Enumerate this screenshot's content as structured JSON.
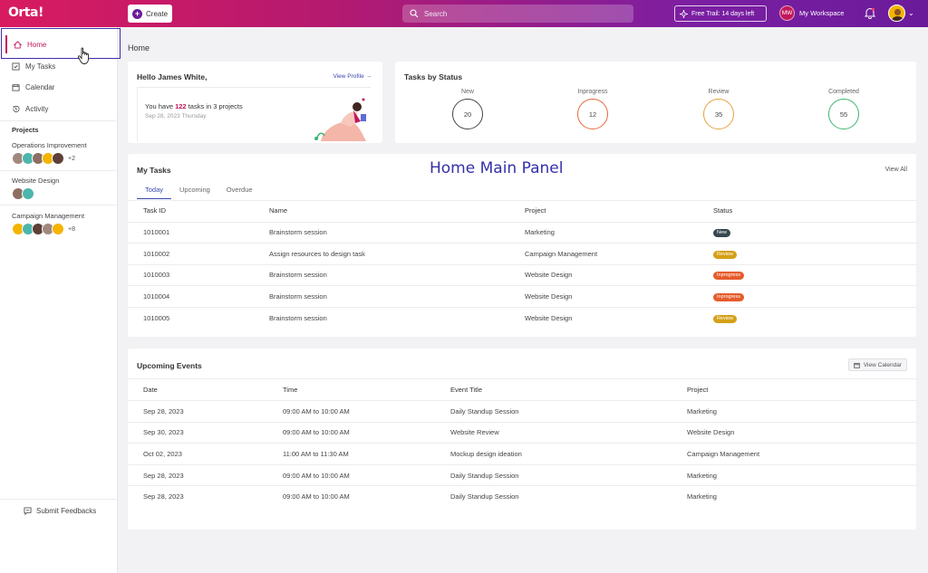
{
  "topbar": {
    "logo": "Orta!",
    "create_label": "Create",
    "search_placeholder": "Search",
    "trial_label": "Free Trail: 14 days left",
    "workspace_initials": "MW",
    "workspace_label": "My Workspace"
  },
  "sidebar": {
    "items": [
      {
        "label": "Home",
        "icon": "home-icon"
      },
      {
        "label": "My Tasks",
        "icon": "checkbox-icon"
      },
      {
        "label": "Calendar",
        "icon": "calendar-icon"
      },
      {
        "label": "Activity",
        "icon": "history-icon"
      }
    ],
    "projects_title": "Projects",
    "projects": [
      {
        "name": "Operations Improvement",
        "more": "+2"
      },
      {
        "name": "Website Design",
        "more": ""
      },
      {
        "name": "Campaign Management",
        "more": "+8"
      }
    ],
    "submit_label": "Submit Feedbacks"
  },
  "breadcrumb": "Home",
  "hello": {
    "title": "Hello James White,",
    "view_profile": "View Profile →",
    "tasks_prefix": "You have ",
    "tasks_count": "122",
    "tasks_suffix": " tasks in 3 projects",
    "date": "Sep 28, 2023 Thursday"
  },
  "status": {
    "title": "Tasks by Status",
    "items": [
      {
        "label": "New",
        "value": "20",
        "color": "#444444"
      },
      {
        "label": "Inprogress",
        "value": "12",
        "color": "#e8663a"
      },
      {
        "label": "Review",
        "value": "35",
        "color": "#e6a23c"
      },
      {
        "label": "Completed",
        "value": "55",
        "color": "#3cb371"
      }
    ]
  },
  "panel_label": "Home Main Panel",
  "my_tasks": {
    "title": "My Tasks",
    "view_all": "View All",
    "tabs": [
      "Today",
      "Upcoming",
      "Overdue"
    ],
    "columns": [
      "Task ID",
      "Name",
      "Project",
      "Status"
    ],
    "rows": [
      {
        "id": "1010001",
        "name": "Brainstorm session",
        "project": "Marketing",
        "status": "New",
        "color": "#37474f"
      },
      {
        "id": "1010002",
        "name": "Assign resources to design task",
        "project": "Campaign Management",
        "status": "Review",
        "color": "#d4a017"
      },
      {
        "id": "1010003",
        "name": "Brainstorm session",
        "project": "Website Design",
        "status": "Inprogress",
        "color": "#e65c2b"
      },
      {
        "id": "1010004",
        "name": "Brainstorm session",
        "project": "Website Design",
        "status": "Inprogress",
        "color": "#e65c2b"
      },
      {
        "id": "1010005",
        "name": "Brainstorm session",
        "project": "Website Design",
        "status": "Review",
        "color": "#d4a017"
      }
    ]
  },
  "events": {
    "title": "Upcoming Events",
    "view_calendar": "View Calendar",
    "columns": [
      "Date",
      "Time",
      "Event Title",
      "Project"
    ],
    "rows": [
      {
        "date": "Sep 28, 2023",
        "time": "09:00 AM to 10:00 AM",
        "title": "Daily Standup Session",
        "project": "Marketing"
      },
      {
        "date": "Sep 30, 2023",
        "time": "09:00 AM to 10:00 AM",
        "title": "Website Review",
        "project": "Website Design"
      },
      {
        "date": "Oct 02, 2023",
        "time": "11:00 AM to 11:30 AM",
        "title": "Mockup design ideation",
        "project": "Campaign Management"
      },
      {
        "date": "Sep 28, 2023",
        "time": "09:00 AM to 10:00 AM",
        "title": "Daily Standup Session",
        "project": "Marketing"
      },
      {
        "date": "Sep 28, 2023",
        "time": "09:00 AM to 10:00 AM",
        "title": "Daily Standup Session",
        "project": "Marketing"
      }
    ]
  }
}
